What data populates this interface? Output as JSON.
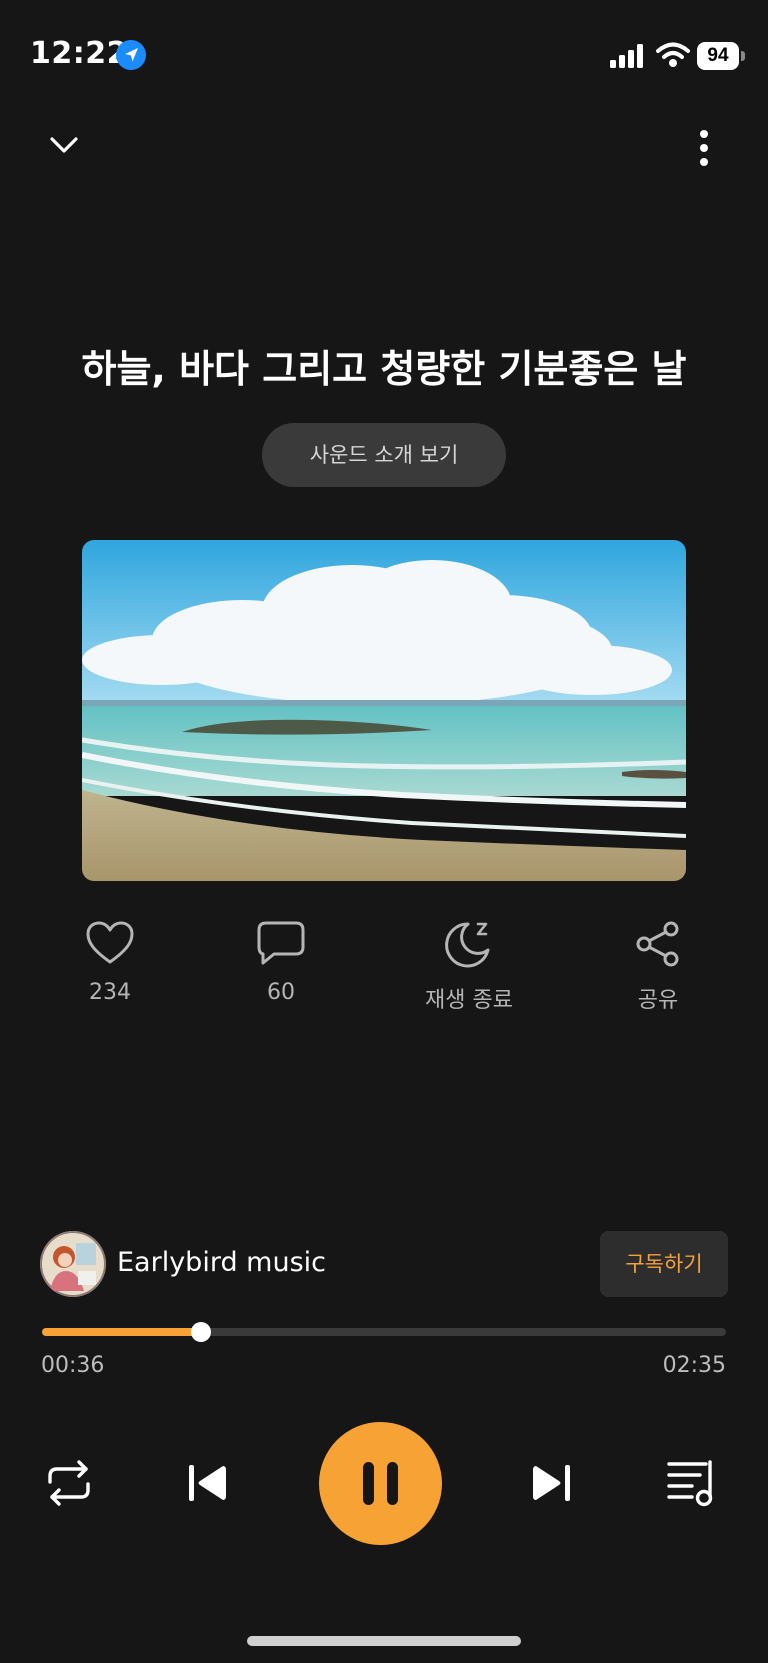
{
  "status_bar": {
    "time": "12:22",
    "battery": "94",
    "icons": [
      "location-arrow-icon",
      "cellular-signal-icon",
      "wifi-icon",
      "battery-icon"
    ]
  },
  "header": {
    "collapse_icon": "chevron-down-icon",
    "more_icon": "more-vertical-icon"
  },
  "track": {
    "title": "하늘, 바다 그리고 청량한 기분좋은 날",
    "intro_label": "사운드 소개 보기",
    "cover": "beach-sky-cover"
  },
  "actions": [
    {
      "icon": "heart-icon",
      "label": "234"
    },
    {
      "icon": "comment-icon",
      "label": "60"
    },
    {
      "icon": "sleep-timer-icon",
      "label": "재생 종료"
    },
    {
      "icon": "share-icon",
      "label": "공유"
    }
  ],
  "channel": {
    "name": "Earlybird music",
    "subscribe_label": "구독하기"
  },
  "player": {
    "current_time": "00:36",
    "total_time": "02:35",
    "progress": 0.232,
    "state": "playing"
  },
  "colors": {
    "background": "#161616",
    "accent": "#f7a235",
    "text_muted": "#b5b5b5"
  }
}
